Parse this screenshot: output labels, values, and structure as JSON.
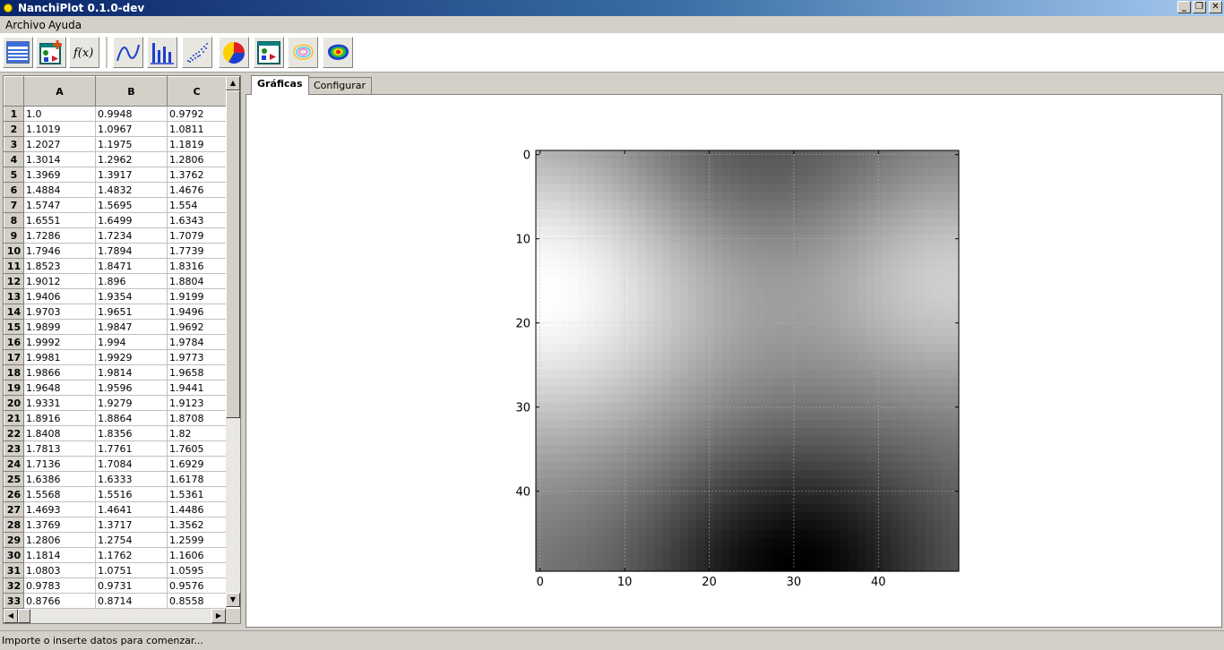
{
  "window": {
    "title": "NanchiPlot 0.1.0-dev",
    "controls": {
      "minimize": "_",
      "restore": "❐",
      "close": "✕"
    }
  },
  "menu": {
    "items": [
      "Archivo",
      "Ayuda"
    ]
  },
  "toolbar": {
    "buttons": [
      {
        "icon": "new-data-grid-icon"
      },
      {
        "icon": "add-chart-icon"
      },
      {
        "icon": "function-fx-icon",
        "label": "f(x)"
      },
      {
        "icon": "line-plot-icon"
      },
      {
        "icon": "bar-chart-icon"
      },
      {
        "icon": "scatter-plot-icon"
      },
      {
        "icon": "pie-chart-icon"
      },
      {
        "icon": "chart-settings-icon"
      },
      {
        "icon": "contour-plot-icon"
      },
      {
        "icon": "filled-contour-icon"
      }
    ]
  },
  "grid": {
    "columns": [
      "A",
      "B",
      "C"
    ],
    "rows": [
      [
        "1",
        "1.0",
        "0.9948",
        "0.9792"
      ],
      [
        "2",
        "1.1019",
        "1.0967",
        "1.0811"
      ],
      [
        "3",
        "1.2027",
        "1.1975",
        "1.1819"
      ],
      [
        "4",
        "1.3014",
        "1.2962",
        "1.2806"
      ],
      [
        "5",
        "1.3969",
        "1.3917",
        "1.3762"
      ],
      [
        "6",
        "1.4884",
        "1.4832",
        "1.4676"
      ],
      [
        "7",
        "1.5747",
        "1.5695",
        "1.554"
      ],
      [
        "8",
        "1.6551",
        "1.6499",
        "1.6343"
      ],
      [
        "9",
        "1.7286",
        "1.7234",
        "1.7079"
      ],
      [
        "10",
        "1.7946",
        "1.7894",
        "1.7739"
      ],
      [
        "11",
        "1.8523",
        "1.8471",
        "1.8316"
      ],
      [
        "12",
        "1.9012",
        "1.896",
        "1.8804"
      ],
      [
        "13",
        "1.9406",
        "1.9354",
        "1.9199"
      ],
      [
        "14",
        "1.9703",
        "1.9651",
        "1.9496"
      ],
      [
        "15",
        "1.9899",
        "1.9847",
        "1.9692"
      ],
      [
        "16",
        "1.9992",
        "1.994",
        "1.9784"
      ],
      [
        "17",
        "1.9981",
        "1.9929",
        "1.9773"
      ],
      [
        "18",
        "1.9866",
        "1.9814",
        "1.9658"
      ],
      [
        "19",
        "1.9648",
        "1.9596",
        "1.9441"
      ],
      [
        "20",
        "1.9331",
        "1.9279",
        "1.9123"
      ],
      [
        "21",
        "1.8916",
        "1.8864",
        "1.8708"
      ],
      [
        "22",
        "1.8408",
        "1.8356",
        "1.82"
      ],
      [
        "23",
        "1.7813",
        "1.7761",
        "1.7605"
      ],
      [
        "24",
        "1.7136",
        "1.7084",
        "1.6929"
      ],
      [
        "25",
        "1.6386",
        "1.6333",
        "1.6178"
      ],
      [
        "26",
        "1.5568",
        "1.5516",
        "1.5361"
      ],
      [
        "27",
        "1.4693",
        "1.4641",
        "1.4486"
      ],
      [
        "28",
        "1.3769",
        "1.3717",
        "1.3562"
      ],
      [
        "29",
        "1.2806",
        "1.2754",
        "1.2599"
      ],
      [
        "30",
        "1.1814",
        "1.1762",
        "1.1606"
      ],
      [
        "31",
        "1.0803",
        "1.0751",
        "1.0595"
      ],
      [
        "32",
        "0.9783",
        "0.9731",
        "0.9576"
      ],
      [
        "33",
        "0.8766",
        "0.8714",
        "0.8558"
      ]
    ]
  },
  "tabs": [
    {
      "label": "Gráficas",
      "active": true
    },
    {
      "label": "Configurar",
      "active": false
    }
  ],
  "chart_data": {
    "type": "heatmap",
    "colormap": "gray",
    "grid": true,
    "xlim": [
      0,
      49
    ],
    "ylim": [
      49,
      0
    ],
    "xticks": [
      0,
      10,
      20,
      30,
      40
    ],
    "yticks": [
      0,
      10,
      20,
      30,
      40
    ],
    "shape": [
      50,
      50
    ],
    "title": "",
    "xlabel": "",
    "ylabel": ""
  },
  "status": {
    "text": "Importe o inserte datos para comenzar..."
  }
}
